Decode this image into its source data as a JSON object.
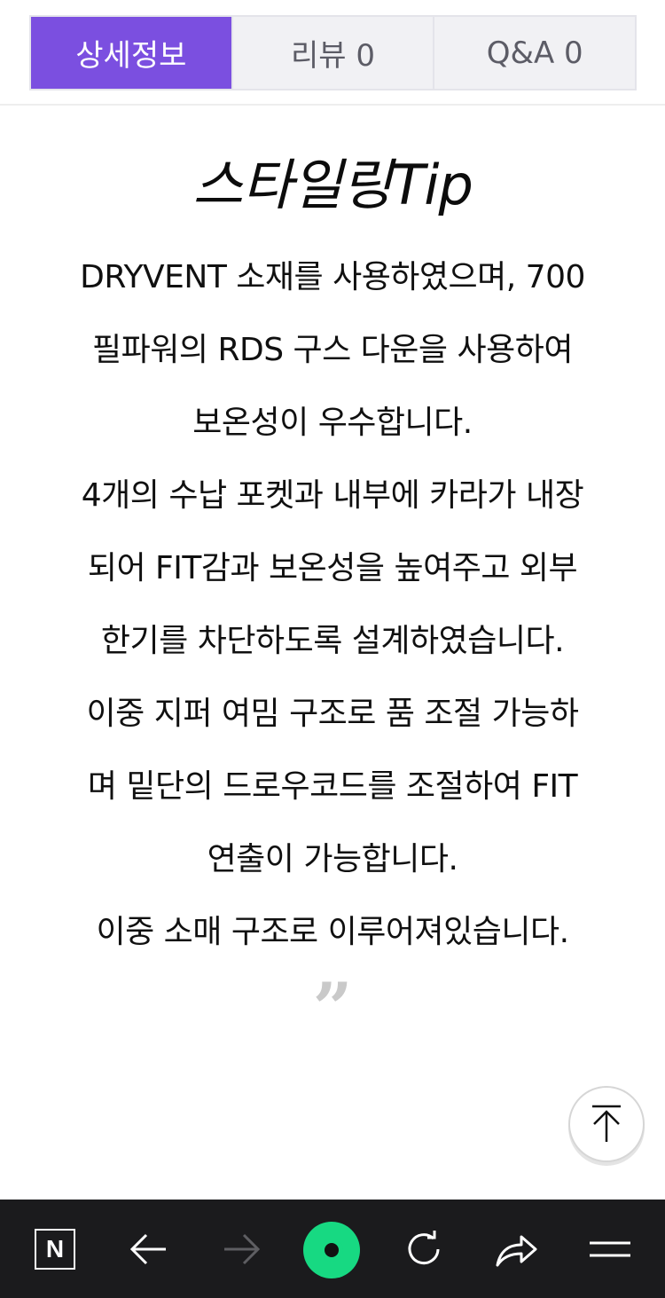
{
  "tabs": [
    {
      "label": "상세정보",
      "active": true
    },
    {
      "label": "리뷰 0",
      "active": false
    },
    {
      "label": "Q&A 0",
      "active": false
    }
  ],
  "content": {
    "headline": "스타일링Tip",
    "lines": [
      "DRYVENT 소재를 사용하였으며, 700",
      "필파워의 RDS 구스 다운을 사용하여",
      "보온성이 우수합니다.",
      "4개의 수납 포켓과 내부에 카라가 내장",
      "되어 FIT감과 보온성을 높여주고 외부",
      "한기를 차단하도록 설계하였습니다.",
      "이중 지퍼 여밈 구조로 품 조절 가능하",
      "며 밑단의 드로우코드를 조절하여 FIT",
      "연출이 가능합니다.",
      "이중 소매 구조로 이루어져있습니다."
    ],
    "quote_mark": "”"
  },
  "scroll_top": {
    "icon": "arrow-up-icon"
  },
  "bottom_bar": {
    "items": [
      "naver-n-icon",
      "back-arrow-icon",
      "forward-arrow-icon",
      "green-home-icon",
      "refresh-icon",
      "share-icon",
      "menu-icon"
    ],
    "logo_letter": "N",
    "accent": "#17d982"
  },
  "colors": {
    "tab_active": "#7b4fe0",
    "tab_inactive_bg": "#f1f1f4",
    "bar_bg": "#1b1b1d"
  }
}
